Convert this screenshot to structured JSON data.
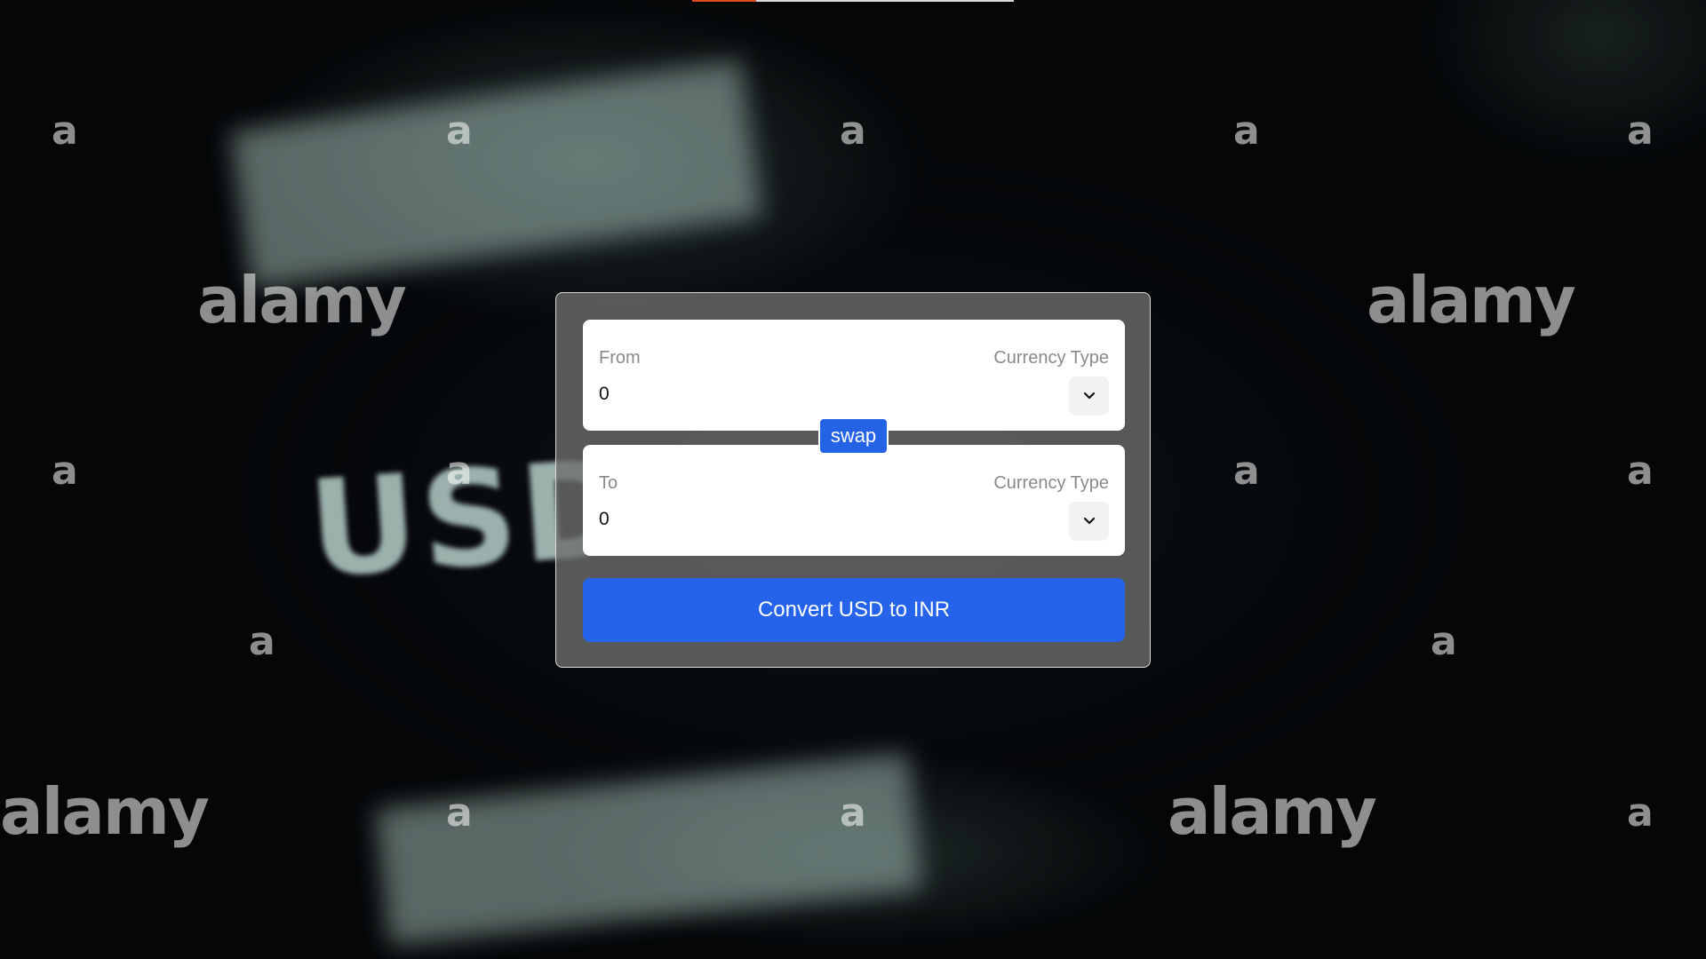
{
  "watermark": {
    "brand": "alamy",
    "mark": "a"
  },
  "background": {
    "foreground_word": "USD"
  },
  "converter": {
    "from": {
      "label": "From",
      "currency_label": "Currency Type",
      "amount": "0",
      "select_icon": "chevron-down-icon"
    },
    "to": {
      "label": "To",
      "currency_label": "Currency Type",
      "amount": "0",
      "select_icon": "chevron-down-icon"
    },
    "swap_label": "swap",
    "convert_label": "Convert USD to INR"
  },
  "colors": {
    "primary": "#2563eb",
    "card_bg": "#6e6e6e",
    "progress_accent": "#e04a1f"
  }
}
